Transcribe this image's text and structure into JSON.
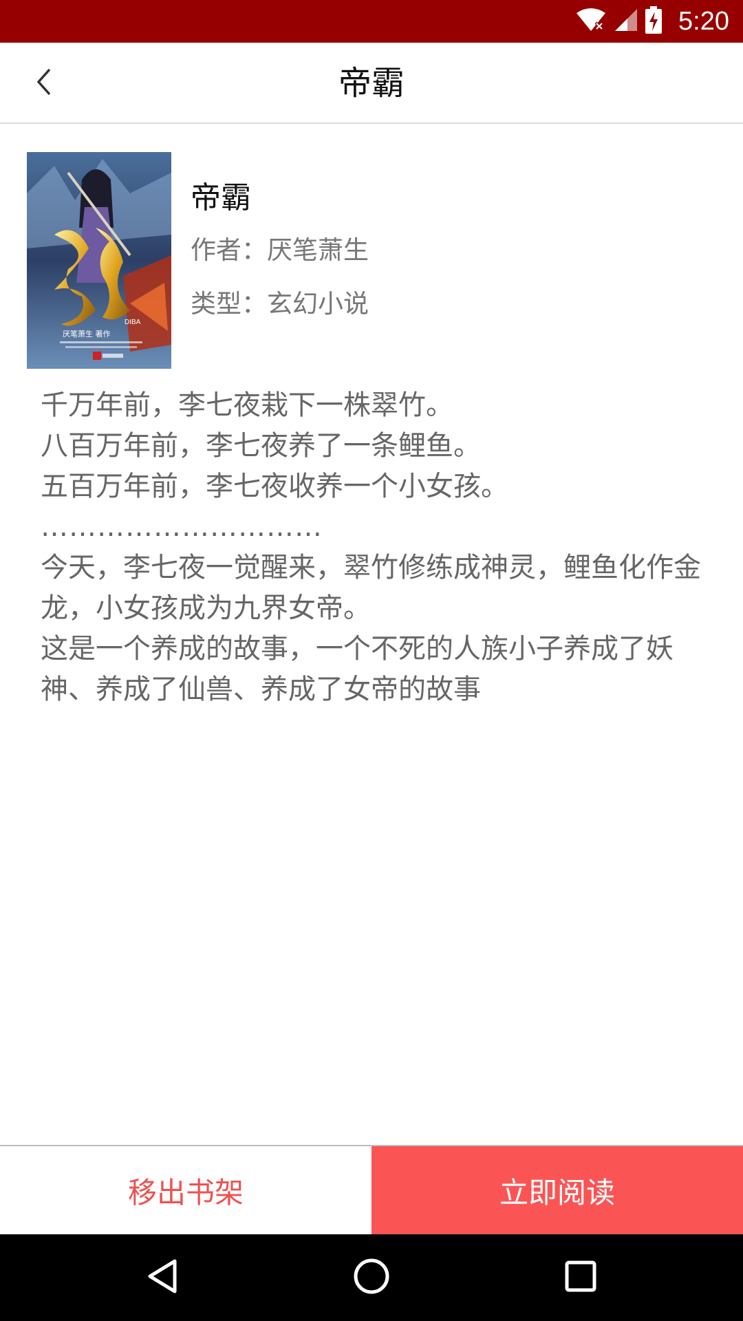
{
  "status_bar": {
    "time": "5:20",
    "icons": [
      "wifi-off-icon",
      "signal-icon",
      "battery-charging-icon"
    ],
    "background": "#970001"
  },
  "app_bar": {
    "title": "帝霸",
    "back_icon": "chevron-left-icon"
  },
  "book": {
    "name": "帝霸",
    "author_line": "作者：厌笔萧生",
    "type_line": "类型：玄幻小说",
    "cover": {
      "title_text": "帝霸",
      "subtitle_text": "DIBA",
      "credit_text": "厌笔萧生 著作"
    }
  },
  "synopsis": [
    "千万年前，李七夜栽下一株翠竹。",
    "八百万年前，李七夜养了一条鲤鱼。",
    "五百万年前，李七夜收养一个小女孩。",
    "…………………………",
    "今天，李七夜一觉醒来，翠竹修练成神灵，鲤鱼化作金龙，小女孩成为九界女帝。",
    "这是一个养成的故事，一个不死的人族小子养成了妖神、养成了仙兽、养成了女帝的故事"
  ],
  "actions": {
    "remove_label": "移出书架",
    "read_label": "立即阅读",
    "accent_color": "#fb5454"
  },
  "nav_bar": {
    "icons": [
      "back-triangle-icon",
      "home-circle-icon",
      "recents-square-icon"
    ]
  }
}
